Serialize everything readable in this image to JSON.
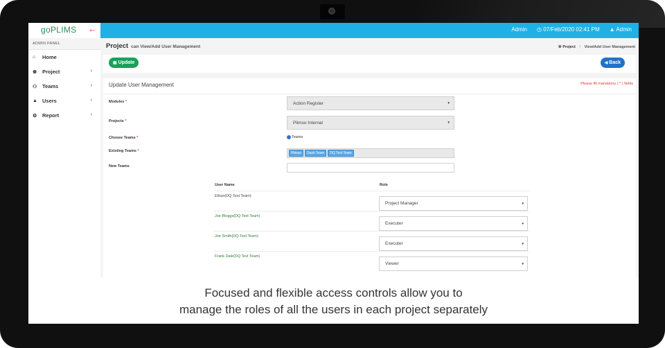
{
  "app": {
    "logo": "goPLIMS",
    "back_icon": "arrow-left-icon"
  },
  "topbar": {
    "user_role": "Admin",
    "datetime": "07/Feb/2020 02:41 PM",
    "user": "Admin"
  },
  "sidebar": {
    "panel_title": "ADMIN PANEL",
    "items": [
      {
        "label": "Home",
        "icon": "home-icon"
      },
      {
        "label": "Project",
        "icon": "sitemap-icon"
      },
      {
        "label": "Teams",
        "icon": "users-icon"
      },
      {
        "label": "Users",
        "icon": "user-icon"
      },
      {
        "label": "Report",
        "icon": "gear-icon"
      }
    ]
  },
  "page": {
    "title": "Project",
    "subtitle": "can View/Add User Management",
    "breadcrumb": [
      "Project",
      "View/Add User Management"
    ]
  },
  "toolbar": {
    "update_label": "Update",
    "back_label": "Back"
  },
  "form": {
    "title": "Update User Management",
    "mandatory_note": "Please fill mandatory ( * ) fields",
    "modules_label": "Modules",
    "modules_value": "Action Register",
    "projects_label": "Projects",
    "projects_value": "Plimso Internal",
    "choose_teams_label": "Choose Teams",
    "choose_teams_option": "Teams",
    "existing_teams_label": "Existing Teams",
    "existing_teams": [
      "Plimso",
      "Dash Team",
      "DQ Test Team"
    ],
    "new_teams_label": "New Teams",
    "new_teams_value": ""
  },
  "users_table": {
    "headers": [
      "User Name",
      "Role"
    ],
    "rows": [
      {
        "name": "Ethan(DQ Test Team)",
        "role": "Project Manager"
      },
      {
        "name": "Joe Bloggs(DQ Test Team)",
        "role": "Executer"
      },
      {
        "name": "Joe Smith(DQ Test Team)",
        "role": "Executer"
      },
      {
        "name": "Frank Dale(DQ Test Team)",
        "role": "Viewer"
      }
    ]
  },
  "caption": {
    "line1": "Focused and flexible access controls allow you to",
    "line2": "manage the roles of all the users in each project separately"
  },
  "colors": {
    "topbar": "#1fb1e6",
    "update_button": "#1aa05a",
    "back_button": "#2372c7",
    "required": "#e53935",
    "tag": "#5aa9e6"
  }
}
